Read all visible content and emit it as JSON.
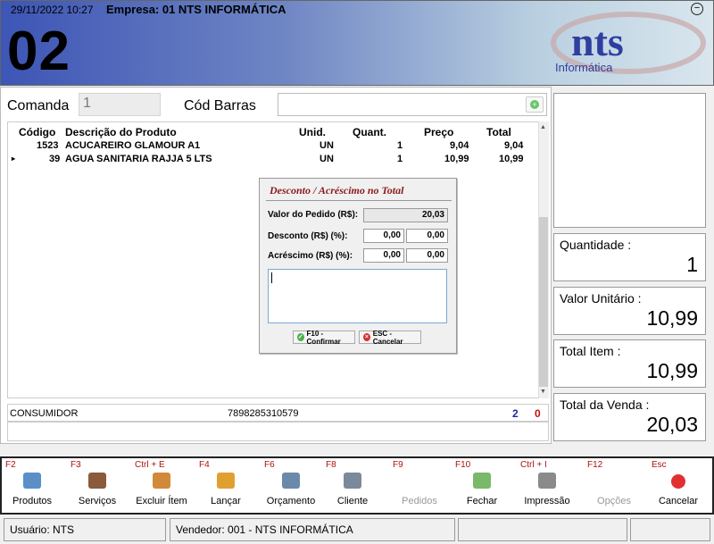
{
  "header": {
    "datetime": "29/11/2022 10:27",
    "empresa": "Empresa: 01 NTS INFORMÁTICA",
    "number": "02",
    "logo_text": "nts",
    "logo_sub": "Informática"
  },
  "form": {
    "comanda_label": "Comanda",
    "comanda_value": "1",
    "barras_label": "Cód Barras"
  },
  "grid": {
    "columns": [
      "Código",
      "Descrição do Produto",
      "Unid.",
      "Quant.",
      "Preço",
      "Total"
    ],
    "rows": [
      {
        "codigo": "1523",
        "descricao": "ACUCAREIRO GLAMOUR A1",
        "unid": "UN",
        "quant": "1",
        "preco": "9,04",
        "total": "9,04"
      },
      {
        "codigo": "39",
        "descricao": "AGUA SANITARIA RAJJA 5 LTS",
        "unid": "UN",
        "quant": "1",
        "preco": "10,99",
        "total": "10,99"
      }
    ]
  },
  "dialog": {
    "title": "Desconto / Acréscimo no Total",
    "valor_label": "Valor do Pedido (R$):",
    "valor_value": "20,03",
    "desconto_label": "Desconto (R$) (%):",
    "desconto_rs": "0,00",
    "desconto_pct": "0,00",
    "acrescimo_label": "Acréscimo (R$) (%):",
    "acrescimo_rs": "0,00",
    "acrescimo_pct": "0,00",
    "confirm_label": "F10 - Confirmar",
    "cancel_label": "ESC - Cancelar"
  },
  "info": {
    "cliente": "CONSUMIDOR",
    "barcode": "7898285310579",
    "count_blue": "2",
    "count_red": "0"
  },
  "right": {
    "quantidade_label": "Quantidade :",
    "quantidade_value": "1",
    "valor_unit_label": "Valor Unitário :",
    "valor_unit_value": "10,99",
    "total_item_label": "Total Item :",
    "total_item_value": "10,99",
    "total_venda_label": "Total da Venda :",
    "total_venda_value": "20,03"
  },
  "toolbar": [
    {
      "key": "F2",
      "label": "Produtos",
      "icon": "products-icon",
      "color": "#5a8fc8"
    },
    {
      "key": "F3",
      "label": "Serviços",
      "icon": "services-icon",
      "color": "#8a5a3a"
    },
    {
      "key": "Ctrl + E",
      "label": "Excluir Ítem",
      "icon": "delete-item-icon",
      "color": "#d08a3a"
    },
    {
      "key": "F4",
      "label": "Lançar",
      "icon": "percent-icon",
      "color": "#e0a030"
    },
    {
      "key": "F6",
      "label": "Orçamento",
      "icon": "calculator-icon",
      "color": "#6a8aaa"
    },
    {
      "key": "F8",
      "label": "Cliente",
      "icon": "client-card-icon",
      "color": "#7a8a9a"
    },
    {
      "key": "F9",
      "label": "Pedidos",
      "icon": "orders-icon",
      "color": "#ffffff"
    },
    {
      "key": "F10",
      "label": "Fechar",
      "icon": "cash-icon",
      "color": "#7ab86a"
    },
    {
      "key": "Ctrl + I",
      "label": "Impressão",
      "icon": "printer-icon",
      "color": "#8a8a8a"
    },
    {
      "key": "F12",
      "label": "Opções",
      "icon": "options-icon",
      "color": "#ffffff"
    },
    {
      "key": "Esc",
      "label": "Cancelar",
      "icon": "cancel-icon",
      "color": "#e03030"
    }
  ],
  "status": {
    "usuario": "Usuário: NTS",
    "vendedor": "Vendedor: 001 - NTS INFORMÁTICA"
  }
}
